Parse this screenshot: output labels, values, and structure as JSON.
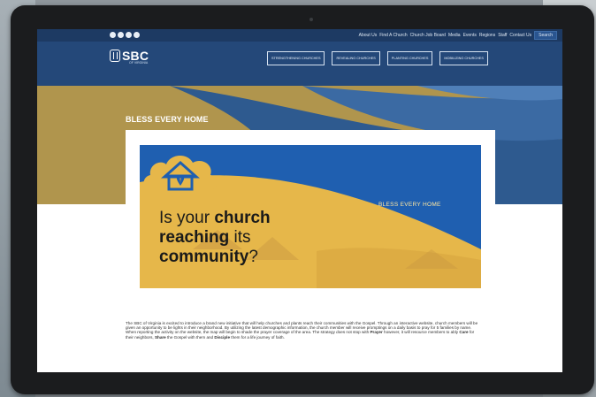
{
  "top_nav": {
    "social_icons": [
      "facebook-icon",
      "twitter-icon",
      "instagram-icon",
      "youtube-icon"
    ],
    "links": [
      "About Us",
      "Find A Church",
      "Church Job Board",
      "Media",
      "Events",
      "Regions",
      "Staff",
      "Contact Us"
    ],
    "search_label": "Search"
  },
  "header": {
    "logo_text": "SBC",
    "logo_subtext": "OF VIRGINIA",
    "nav_buttons": [
      "STRENGTHENING CHURCHES",
      "REVEALING CHURCHES",
      "PLANTING CHURCHES",
      "MOBILIZING CHURCHES"
    ]
  },
  "hero": {
    "title": "BLESS EVERY HOME"
  },
  "banner": {
    "brand": "BLESS EVERY HOME",
    "headline": {
      "line1_a": "Is your ",
      "line1_b": "church",
      "line2_a": "reaching",
      "line2_b": " its",
      "line3_a": "community",
      "line3_b": "?"
    }
  },
  "body": {
    "t1": "The SBC of Virginia is excited to introduce a brand new initiative that will help churches and plants reach their communities with the Gospel. Through an interactive website, church members will be given an opportunity to be lights in their neighborhood. By utilizing the latest demographic information, the church member will receive promptings on a daily basis to pray for 5 families by name. When reporting the activity on the website, the map will begin to shade the prayer coverage of the area. The strategy does not stop with ",
    "b1": "Prayer",
    "t2": " however, it will resource members to ably ",
    "b2": "Care",
    "t3": " for their neighbors, ",
    "b3": "Share",
    "t4": " the Gospel with them and ",
    "b4": "Disciple",
    "t5": " them for a life journey of faith."
  },
  "colors": {
    "nav_bg": "#1d3a63",
    "header_bg": "#244879",
    "gold": "#b0954d",
    "banner_blue": "#1f5fb0",
    "banner_gold": "#e6b74a"
  }
}
